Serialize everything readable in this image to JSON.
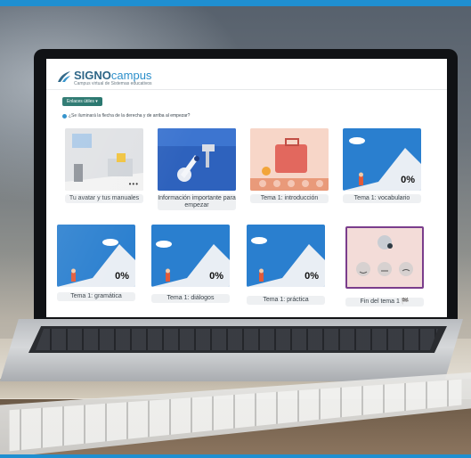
{
  "brand": {
    "name_part1": "SIGNO",
    "name_part2": "campus",
    "tagline": "Campus virtual de Sistemas educativos"
  },
  "toolbar": {
    "dropdown_label": "Enlaces útiles ▾"
  },
  "notice": {
    "text": "¿Se iluminará la flecha de la derecha y de arriba al empezar?"
  },
  "tiles": [
    {
      "caption": "Tu avatar y tus manuales",
      "badge": "•••"
    },
    {
      "caption": "Información importante para empezar",
      "badge": ""
    },
    {
      "caption": "Tema 1: introducción",
      "badge": ""
    },
    {
      "caption": "Tema 1: vocabulario",
      "badge": "0%"
    },
    {
      "caption": "Tema 1: gramática",
      "badge": "0%"
    },
    {
      "caption": "Tema 1: diálogos",
      "badge": "0%"
    },
    {
      "caption": "Tema 1: práctica",
      "badge": "0%"
    },
    {
      "caption": "Fin del tema 1 🏁",
      "badge": ""
    }
  ],
  "colors": {
    "accent": "#1f8fd1",
    "button": "#12685f",
    "progress_sky": "#2a7fcf"
  }
}
